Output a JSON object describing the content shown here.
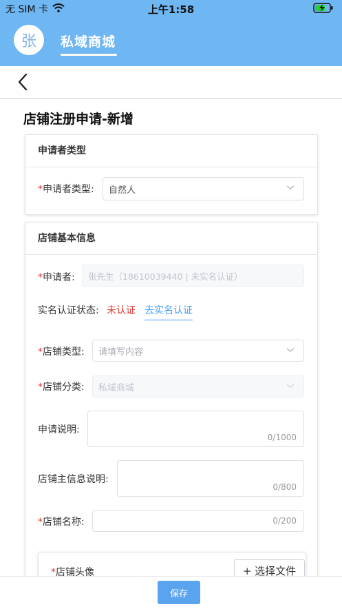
{
  "status_bar": {
    "carrier": "无 SIM 卡",
    "time": "上午1:58",
    "icons": [
      "wifi-icon",
      "battery-charging-icon"
    ]
  },
  "app_bar": {
    "avatar_text": "张",
    "title": "私域商城"
  },
  "nav": {
    "back_icon": "chevron-left-icon"
  },
  "page": {
    "title": "店铺注册申请-新增"
  },
  "applicant_type_card": {
    "header": "申请者类型",
    "field_label": "申请者类型:",
    "value": "自然人"
  },
  "basic_info_card": {
    "header": "店铺基本信息",
    "applicant": {
      "label": "申请者:",
      "value": "张先生（18610039440 | 未实名认证）"
    },
    "verify": {
      "label": "实名认证状态:",
      "status": "未认证",
      "link": "去实名认证",
      "status_color": "#e53935",
      "link_color": "#409eff"
    },
    "shop_type": {
      "label": "店铺类型:",
      "placeholder": "请填写内容"
    },
    "shop_category": {
      "label": "店铺分类:",
      "value": "私域商城"
    },
    "apply_desc": {
      "label": "申请说明:",
      "counter": "0/1000"
    },
    "main_info_desc": {
      "label": "店铺主信息说明:",
      "counter": "0/800"
    },
    "shop_name": {
      "label": "店铺名称:",
      "counter": "0/200"
    },
    "shop_avatar": {
      "label": "店铺头像",
      "button": "+ 选择文件"
    }
  },
  "footer": {
    "save_label": "保存"
  },
  "colors": {
    "primary": "#6fb7f3",
    "button": "#5aa3ee",
    "required": "#e53935"
  }
}
